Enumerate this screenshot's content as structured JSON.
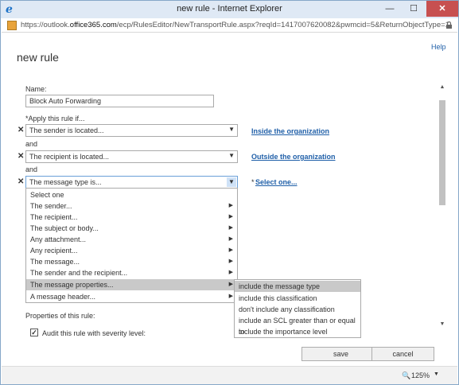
{
  "window": {
    "title": "new rule - Internet Explorer",
    "minimize_glyph": "—",
    "maximize_glyph": "☐",
    "close_glyph": "✕"
  },
  "address": {
    "url_prefix": "https://outlook.",
    "url_domain": "office365.com",
    "url_rest": "/ecp/RulesEditor/NewTransportRule.aspx?reqId=1417007620082&pwmcid=5&ReturnObjectType=1"
  },
  "page": {
    "title": "new rule",
    "help": "Help"
  },
  "form": {
    "name_label": "Name:",
    "name_value": "Block Auto Forwarding",
    "apply_label": "*Apply this rule if...",
    "and_1": "and",
    "and_2": "and",
    "conditions": [
      {
        "value": "The sender is located...",
        "link": "Inside the organization"
      },
      {
        "value": "The recipient is located...",
        "link": "Outside the organization"
      },
      {
        "value": "The message type is...",
        "link": "Select one...",
        "link_prefix": "*"
      }
    ],
    "properties_label": "Properties of this rule:",
    "audit_label": "Audit this rule with severity level:",
    "audit_checked": true
  },
  "dropdown": {
    "items": [
      {
        "label": "Select one",
        "has_submenu": false
      },
      {
        "label": "The sender...",
        "has_submenu": true
      },
      {
        "label": "The recipient...",
        "has_submenu": true
      },
      {
        "label": "The subject or body...",
        "has_submenu": true
      },
      {
        "label": "Any attachment...",
        "has_submenu": true
      },
      {
        "label": "Any recipient...",
        "has_submenu": true
      },
      {
        "label": "The message...",
        "has_submenu": true
      },
      {
        "label": "The sender and the recipient...",
        "has_submenu": true
      },
      {
        "label": "The message properties...",
        "has_submenu": true,
        "selected": true
      },
      {
        "label": "A message header...",
        "has_submenu": true
      }
    ]
  },
  "submenu": {
    "items": [
      {
        "label": "include the message type",
        "selected": true
      },
      {
        "label": "include this classification"
      },
      {
        "label": "don't include any classification"
      },
      {
        "label": "include an SCL greater than or equal to"
      },
      {
        "label": "include the importance level"
      }
    ]
  },
  "buttons": {
    "save": "save",
    "cancel": "cancel"
  },
  "status": {
    "zoom": "125%"
  }
}
